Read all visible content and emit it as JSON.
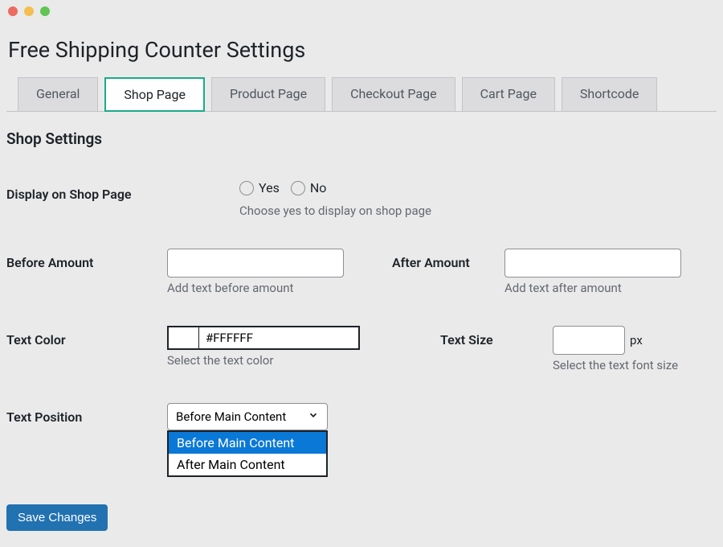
{
  "page_title": "Free Shipping Counter Settings",
  "tabs": [
    {
      "label": "General",
      "active": false
    },
    {
      "label": "Shop Page",
      "active": true
    },
    {
      "label": "Product Page",
      "active": false
    },
    {
      "label": "Checkout Page",
      "active": false
    },
    {
      "label": "Cart Page",
      "active": false
    },
    {
      "label": "Shortcode",
      "active": false
    }
  ],
  "section_title": "Shop Settings",
  "display_on_shop": {
    "label": "Display on Shop Page",
    "option_yes": "Yes",
    "option_no": "No",
    "hint": "Choose yes to display on shop page"
  },
  "before_amount": {
    "label": "Before Amount",
    "value": "",
    "hint": "Add text before amount"
  },
  "after_amount": {
    "label": "After Amount",
    "value": "",
    "hint": "Add text after amount"
  },
  "text_color": {
    "label": "Text Color",
    "value": "#FFFFFF",
    "hint": "Select the text color"
  },
  "text_size": {
    "label": "Text Size",
    "value": "",
    "suffix": "px",
    "hint": "Select the text font size"
  },
  "text_position": {
    "label": "Text Position",
    "selected": "Before Main Content",
    "options": [
      "Before Main Content",
      "After Main Content"
    ]
  },
  "save_button": "Save Changes"
}
